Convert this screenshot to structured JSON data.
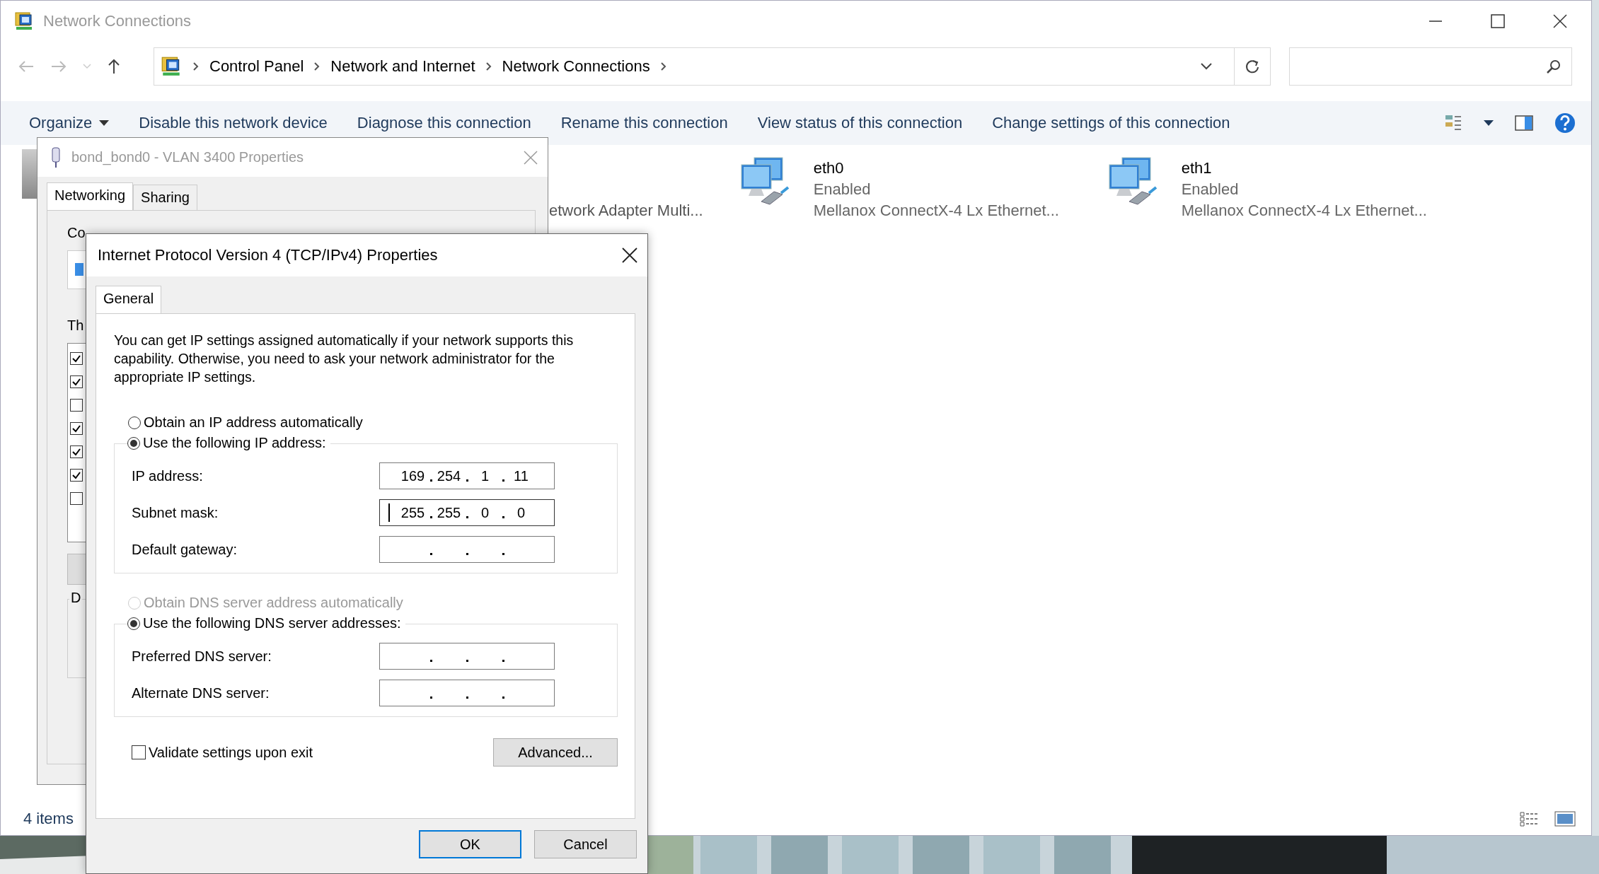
{
  "explorer": {
    "title": "Network Connections",
    "breadcrumb": [
      "Control Panel",
      "Network and Internet",
      "Network Connections"
    ],
    "toolbar": [
      "Organize",
      "Disable this network device",
      "Diagnose this connection",
      "Rename this connection",
      "View status of this connection",
      "Change settings of this connection"
    ],
    "partial_item": "etwork Adapter Multi...",
    "items": [
      {
        "name": "eth0",
        "status": "Enabled",
        "device": "Mellanox ConnectX-4 Lx Ethernet..."
      },
      {
        "name": "eth1",
        "status": "Enabled",
        "device": "Mellanox ConnectX-4 Lx Ethernet..."
      }
    ],
    "status_bar": "4 items"
  },
  "bond_dialog": {
    "title": "bond_bond0 - VLAN 3400 Properties",
    "tabs": [
      {
        "label": "Networking",
        "selected": true
      },
      {
        "label": "Sharing",
        "selected": false
      }
    ],
    "connect_label": "Co",
    "list_label": "Th",
    "components": [
      {
        "checked": true
      },
      {
        "checked": true
      },
      {
        "checked": false
      },
      {
        "checked": true
      },
      {
        "checked": true
      },
      {
        "checked": true
      },
      {
        "checked": false
      }
    ],
    "group_label": "D"
  },
  "ipv4_dialog": {
    "title": "Internet Protocol Version 4 (TCP/IPv4) Properties",
    "tabs": [
      {
        "label": "General",
        "selected": true
      }
    ],
    "description": "You can get IP settings assigned automatically if your network supports this capability. Otherwise, you need to ask your network administrator for the appropriate IP settings.",
    "ip_auto": {
      "label": "Obtain an IP address automatically",
      "selected": false,
      "disabled": false
    },
    "ip_manual": {
      "label": "Use the following IP address:",
      "selected": true,
      "disabled": false
    },
    "ip_fields": [
      {
        "label": "IP address:",
        "octets": [
          "169",
          "254",
          "1",
          "11"
        ],
        "focused": false
      },
      {
        "label": "Subnet mask:",
        "octets": [
          "255",
          "255",
          "0",
          "0"
        ],
        "focused": true
      },
      {
        "label": "Default gateway:",
        "focused": false
      }
    ],
    "dns_auto": {
      "label": "Obtain DNS server address automatically",
      "selected": false,
      "disabled": true
    },
    "dns_manual": {
      "label": "Use the following DNS server addresses:",
      "selected": true,
      "disabled": false
    },
    "dns_fields": [
      {
        "label": "Preferred DNS server:",
        "focused": false
      },
      {
        "label": "Alternate DNS server:",
        "focused": false
      }
    ],
    "validate": {
      "label": "Validate settings upon exit",
      "checked": false
    },
    "advanced_button": "Advanced...",
    "ok_button": "OK",
    "cancel_button": "Cancel"
  }
}
